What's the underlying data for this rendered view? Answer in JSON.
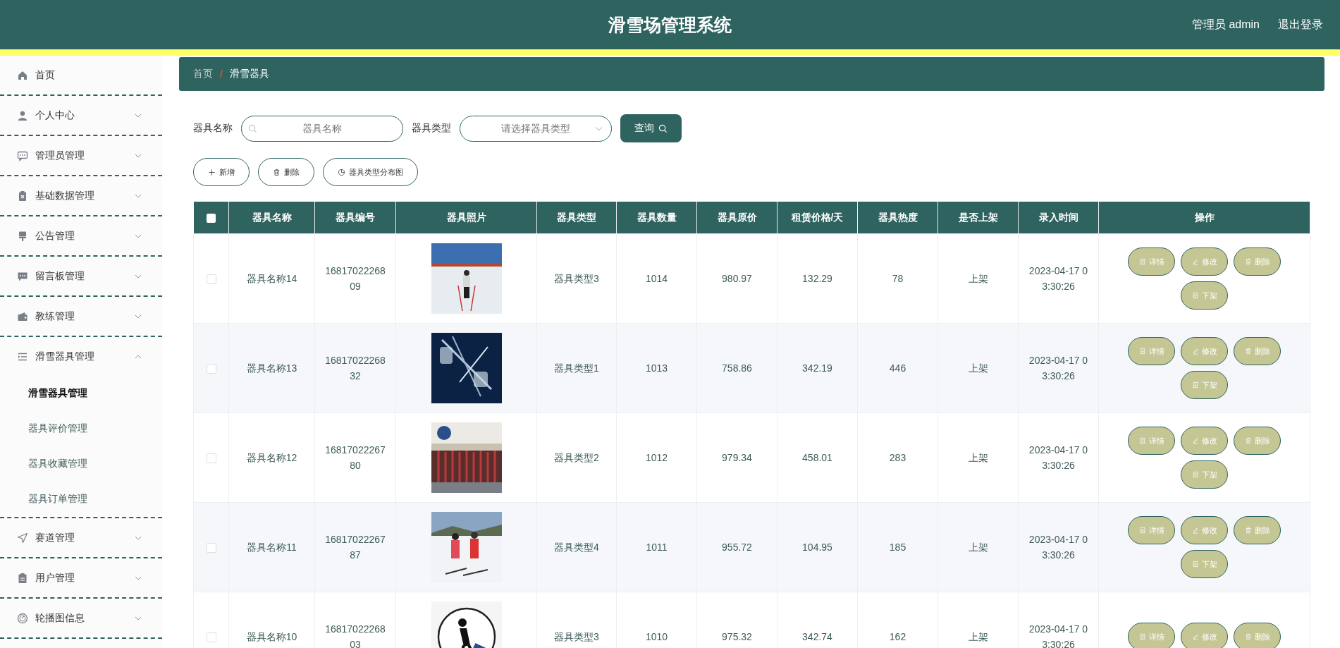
{
  "header": {
    "title": "滑雪场管理系统",
    "user": "管理员 admin",
    "logout": "退出登录"
  },
  "sidebar": {
    "items": [
      {
        "label": "首页"
      },
      {
        "label": "个人中心",
        "expanded": false
      },
      {
        "label": "管理员管理",
        "expanded": false
      },
      {
        "label": "基础数据管理",
        "expanded": false
      },
      {
        "label": "公告管理",
        "expanded": false
      },
      {
        "label": "留言板管理",
        "expanded": false
      },
      {
        "label": "教练管理",
        "expanded": false
      },
      {
        "label": "滑雪器具管理",
        "expanded": true,
        "children": [
          {
            "label": "滑雪器具管理",
            "selected": true
          },
          {
            "label": "器具评价管理",
            "selected": false
          },
          {
            "label": "器具收藏管理",
            "selected": false
          },
          {
            "label": "器具订单管理",
            "selected": false
          }
        ]
      },
      {
        "label": "赛道管理",
        "expanded": false
      },
      {
        "label": "用户管理",
        "expanded": false
      },
      {
        "label": "轮播图信息",
        "expanded": false
      }
    ]
  },
  "breadcrumb": {
    "separator": "/",
    "items": [
      "首页",
      "滑雪器具"
    ]
  },
  "search": {
    "name_label": "器具名称",
    "name_placeholder": "器具名称",
    "type_label": "器具类型",
    "type_placeholder": "请选择器具类型",
    "query_button": "查询"
  },
  "toolbar": [
    {
      "label": "新增",
      "kind": "add"
    },
    {
      "label": "删除",
      "kind": "delete"
    },
    {
      "label": "器具类型分布图",
      "kind": "chart"
    }
  ],
  "table": {
    "all_checked": false,
    "columns": [
      "器具名称",
      "器具编号",
      "器具照片",
      "器具类型",
      "器具数量",
      "器具原价",
      "租赁价格/天",
      "器具热度",
      "是否上架",
      "录入时间",
      "操作"
    ],
    "rows": [
      {
        "checked": false,
        "name": "器具名称14",
        "code": "1681702226809",
        "type": "器具类型3",
        "qty": "1014",
        "price": "980.97",
        "rent": "132.29",
        "heat": "78",
        "shelf": "上架",
        "time": "2023-04-17 03:30:26",
        "actions": [
          {
            "label": "详情",
            "kind": "detail"
          },
          {
            "label": "修改",
            "kind": "edit"
          },
          {
            "label": "删除",
            "kind": "delete"
          },
          {
            "label": "下架",
            "kind": "offshelf"
          }
        ]
      },
      {
        "checked": false,
        "name": "器具名称13",
        "code": "1681702226832",
        "type": "器具类型1",
        "qty": "1013",
        "price": "758.86",
        "rent": "342.19",
        "heat": "446",
        "shelf": "上架",
        "time": "2023-04-17 03:30:26",
        "actions": [
          {
            "label": "详情",
            "kind": "detail"
          },
          {
            "label": "修改",
            "kind": "edit"
          },
          {
            "label": "删除",
            "kind": "delete"
          },
          {
            "label": "下架",
            "kind": "offshelf"
          }
        ]
      },
      {
        "checked": false,
        "name": "器具名称12",
        "code": "1681702226780",
        "type": "器具类型2",
        "qty": "1012",
        "price": "979.34",
        "rent": "458.01",
        "heat": "283",
        "shelf": "上架",
        "time": "2023-04-17 03:30:26",
        "actions": [
          {
            "label": "详情",
            "kind": "detail"
          },
          {
            "label": "修改",
            "kind": "edit"
          },
          {
            "label": "删除",
            "kind": "delete"
          },
          {
            "label": "下架",
            "kind": "offshelf"
          }
        ]
      },
      {
        "checked": false,
        "name": "器具名称11",
        "code": "1681702226787",
        "type": "器具类型4",
        "qty": "1011",
        "price": "955.72",
        "rent": "104.95",
        "heat": "185",
        "shelf": "上架",
        "time": "2023-04-17 03:30:26",
        "actions": [
          {
            "label": "详情",
            "kind": "detail"
          },
          {
            "label": "修改",
            "kind": "edit"
          },
          {
            "label": "删除",
            "kind": "delete"
          },
          {
            "label": "下架",
            "kind": "offshelf"
          }
        ]
      },
      {
        "checked": false,
        "name": "器具名称10",
        "code": "1681702226803",
        "type": "器具类型3",
        "qty": "1010",
        "price": "975.32",
        "rent": "342.74",
        "heat": "162",
        "shelf": "上架",
        "time": "2023-04-17 03:30:26",
        "actions": [
          {
            "label": "详情",
            "kind": "detail"
          },
          {
            "label": "修改",
            "kind": "edit"
          },
          {
            "label": "删除",
            "kind": "delete"
          }
        ]
      }
    ]
  }
}
